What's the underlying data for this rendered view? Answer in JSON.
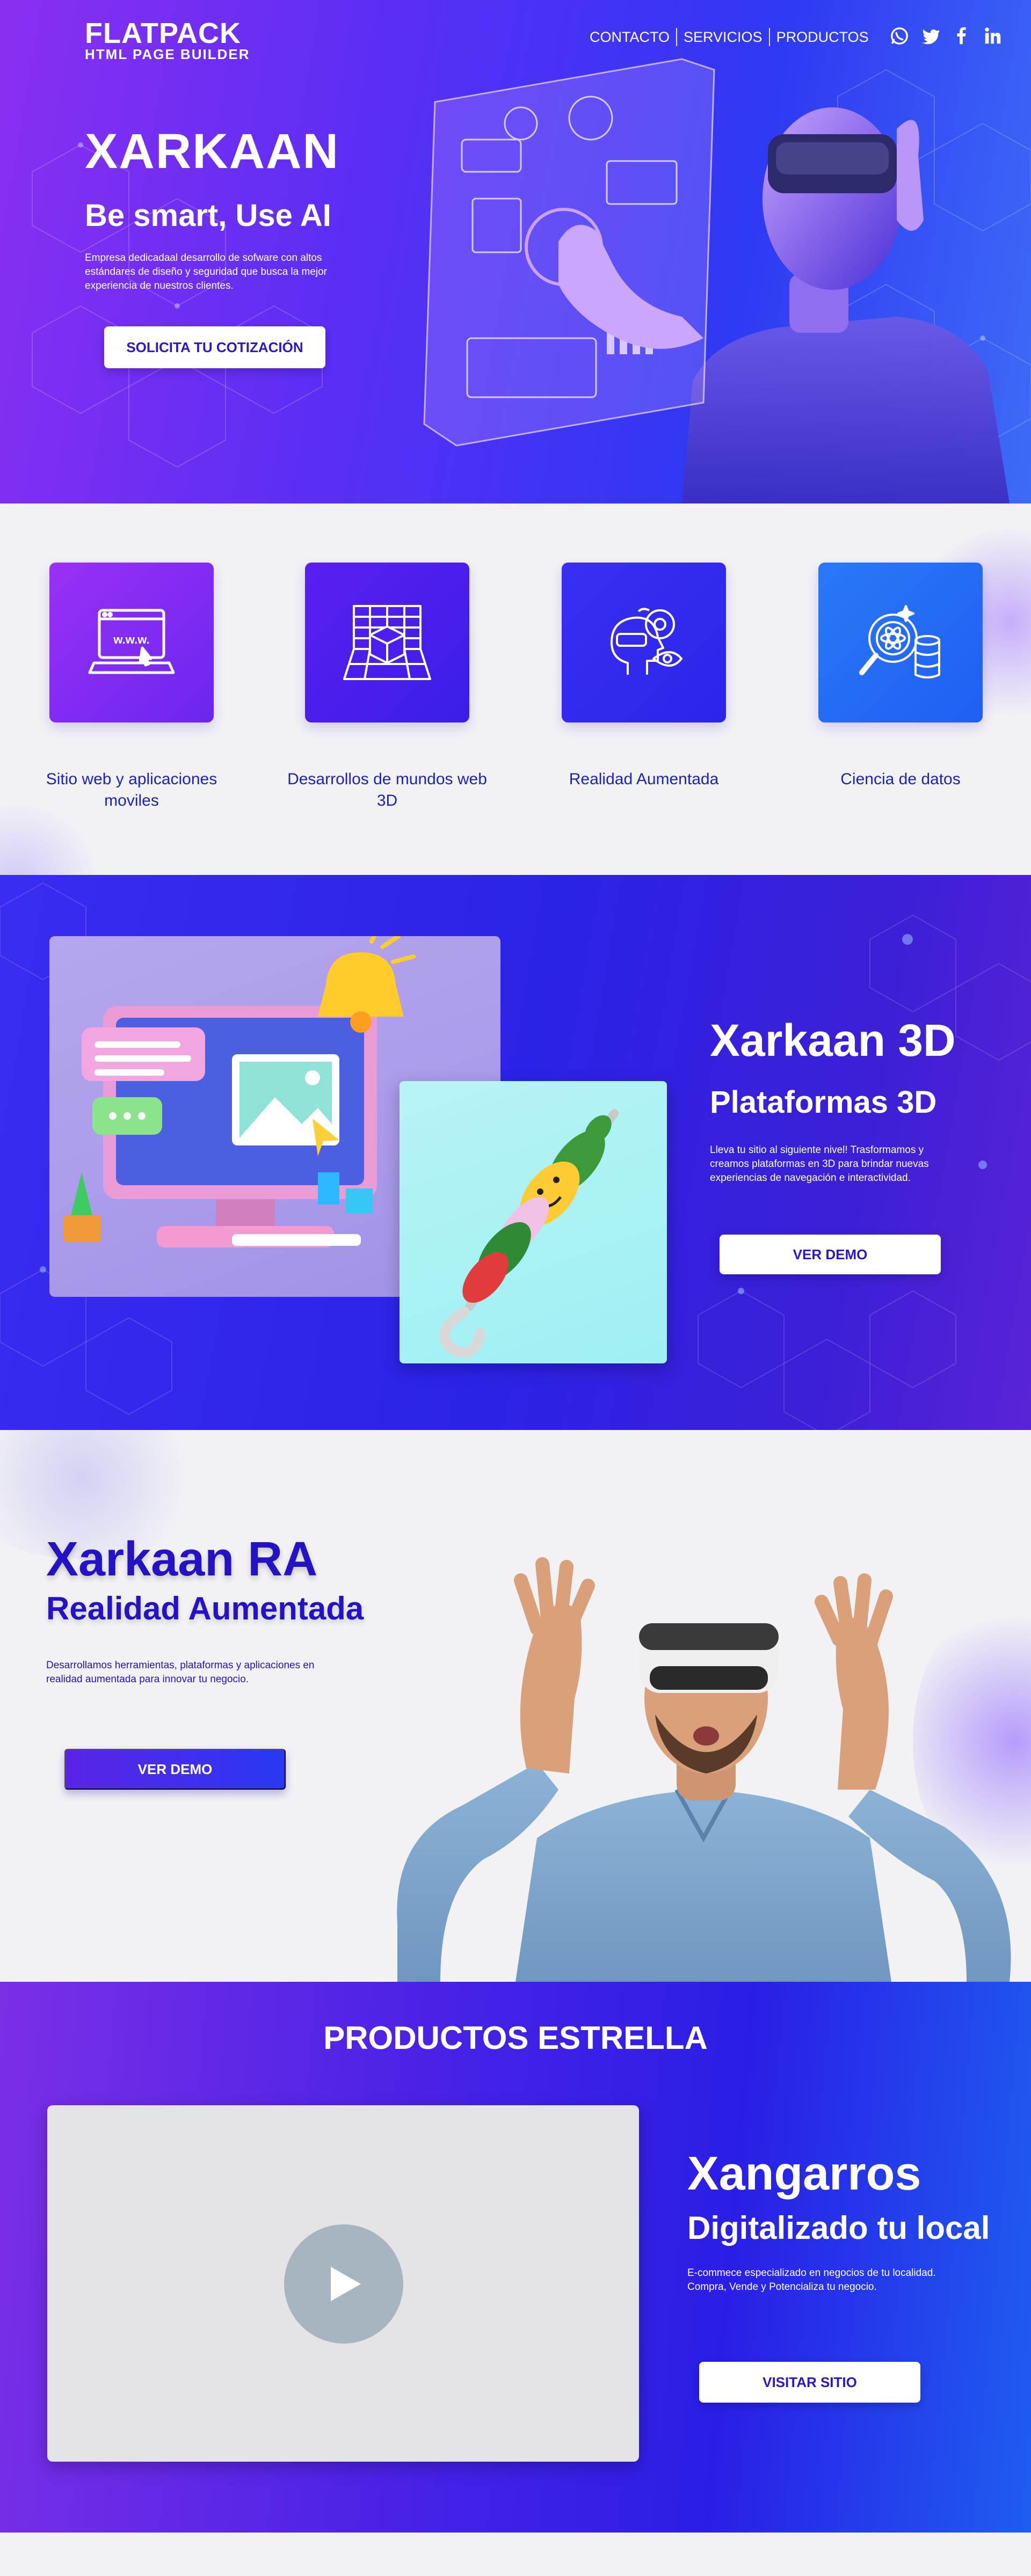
{
  "header": {
    "logo_main": "FLATPACK",
    "logo_sub": "HTML PAGE BUILDER",
    "nav": [
      "CONTACTO",
      "SERVICIOS",
      "PRODUCTOS"
    ],
    "social_icons": [
      "whatsapp-icon",
      "twitter-icon",
      "facebook-icon",
      "linkedin-icon"
    ]
  },
  "hero": {
    "title": "XARKAAN",
    "subtitle": "Be smart, Use AI",
    "description": "Empresa dedicadaal desarrollo de sofware con altos estándares de diseño y seguridad que busca la mejor experiencia de nuestros clientes.",
    "cta": "SOLICITA TU COTIZACIÓN"
  },
  "services": [
    {
      "label": "Sitio web y aplicaciones moviles",
      "icon": "web-laptop-icon",
      "color": "#8a2cf4"
    },
    {
      "label": "Desarrollos de mundos web 3D",
      "icon": "3d-cube-grid-icon",
      "color": "#4a1ff0"
    },
    {
      "label": "Realidad Aumentada",
      "icon": "augmented-reality-head-icon",
      "color": "#2f2ef2"
    },
    {
      "label": "Ciencia de datos",
      "icon": "data-science-icon",
      "color": "#1f7df7"
    }
  ],
  "platforms3d": {
    "title": "Xarkaan 3D",
    "subtitle": "Plataformas 3D",
    "description": "Lleva tu sitio al siguiente nivel! Trasformamos y creamos plataformas en 3D para brindar nuevas experiencias de navegación e interactividad.",
    "cta": "VER DEMO"
  },
  "ar": {
    "title": "Xarkaan RA",
    "subtitle": "Realidad Aumentada",
    "description": "Desarrollamos herramientas, plataformas y aplicaciones en realidad aumentada para innovar tu negocio.",
    "cta": "VER DEMO"
  },
  "products": {
    "heading": "PRODUCTOS ESTRELLA",
    "title": "Xangarros",
    "subtitle": "Digitalizado tu local",
    "description": "E-commece especializado en negocios de tu localidad. Compra, Vende y Potencializa tu negocio.",
    "cta": "VISITAR SITIO"
  },
  "colors": {
    "brand_blue": "#2312c6",
    "brand_purple": "#8a2ff0",
    "accent_blue": "#2f38f2"
  }
}
